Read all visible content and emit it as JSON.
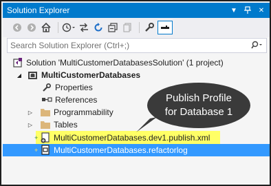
{
  "window": {
    "title": "Solution Explorer",
    "controls": [
      "dropdown-icon",
      "pin-icon",
      "close-icon"
    ]
  },
  "toolbar": {
    "icons": [
      "back-icon",
      "forward-icon",
      "home-icon",
      "history-icon",
      "sync-icon",
      "refresh-icon",
      "collapse-all-icon",
      "show-all-files-icon",
      "properties-icon",
      "preview-icon"
    ]
  },
  "search": {
    "placeholder": "Search Solution Explorer (Ctrl+;)"
  },
  "tree": {
    "solution": "Solution 'MultiCustomerDatabasesSolution' (1 project)",
    "project": "MultiCustomerDatabases",
    "items": [
      {
        "label": "Properties"
      },
      {
        "label": "References"
      },
      {
        "label": "Programmability"
      },
      {
        "label": "Tables"
      },
      {
        "label": "MultiCustomerDatabases.dev1.publish.xml"
      },
      {
        "label": "MultiCustomerDatabases.refactorlog"
      }
    ]
  },
  "callout": {
    "line1": "Publish Profile",
    "line2": "for Database 1"
  },
  "colors": {
    "titlebar": "#007acc",
    "selection": "#3399ff",
    "highlight": "#ffff66",
    "callout": "#3a3a3a"
  }
}
